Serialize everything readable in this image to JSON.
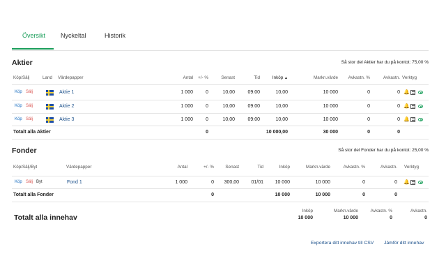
{
  "tabs": [
    "Översikt",
    "Nyckeltal",
    "Historik"
  ],
  "aktier": {
    "title": "Aktier",
    "info": "Så stor del Aktier har du på kontot: 75,00 %",
    "headers": [
      "Köp/Sälj",
      "Land",
      "Värdepapper",
      "Antal",
      "+/- %",
      "Senast",
      "Tid",
      "Inköp",
      "Markn.värde",
      "Avkastn. %",
      "Avkastn.",
      "Verktyg"
    ],
    "sort_indicator": "▲",
    "buy_label": "Köp",
    "sell_label": "Sälj",
    "rows": [
      {
        "name": "Aktie 1",
        "antal": "1 000",
        "change": "0",
        "senast": "10,00",
        "tid": "09:00",
        "inkop": "10,00",
        "marknvarde": "10 000",
        "avkastn_pct": "0",
        "avkastn": "0",
        "bell": "dark"
      },
      {
        "name": "Aktie 2",
        "antal": "1 000",
        "change": "0",
        "senast": "10,00",
        "tid": "09:00",
        "inkop": "10,00",
        "marknvarde": "10 000",
        "avkastn_pct": "0",
        "avkastn": "0",
        "bell": "green"
      },
      {
        "name": "Aktie 3",
        "antal": "1 000",
        "change": "0",
        "senast": "10,00",
        "tid": "09:00",
        "inkop": "10,00",
        "marknvarde": "10 000",
        "avkastn_pct": "0",
        "avkastn": "0",
        "bell": "dark"
      }
    ],
    "total": {
      "label": "Totalt alla Aktier",
      "change": "0",
      "inkop": "10 000,00",
      "marknvarde": "30 000",
      "avkastn_pct": "0",
      "avkastn": "0"
    }
  },
  "fonder": {
    "title": "Fonder",
    "info": "Så stor del Fonder har du på kontot: 25,00 %",
    "headers": [
      "Köp/Sälj/Byt",
      "Värdepapper",
      "Antal",
      "+/- %",
      "Senast",
      "Tid",
      "Inköp",
      "Markn.värde",
      "Avkastn. %",
      "Avkastn.",
      "Verktyg"
    ],
    "buy_label": "Köp",
    "sell_label": "Sälj",
    "swap_label": "Byt",
    "rows": [
      {
        "name": "Fond 1",
        "antal": "1 000",
        "change": "0",
        "senast": "300,00",
        "tid": "01/01",
        "inkop": "10 000",
        "marknvarde": "10 000",
        "avkastn_pct": "0",
        "avkastn": "0"
      }
    ],
    "total": {
      "label": "Totalt alla Fonder",
      "change": "0",
      "inkop": "10 000",
      "marknvarde": "10 000",
      "avkastn_pct": "0",
      "avkastn": "0"
    }
  },
  "summary": {
    "title": "Totalt alla innehav",
    "headers": [
      "Inköp",
      "Markn.värde",
      "Avkastn. %",
      "Avkastn."
    ],
    "values": [
      "10 000",
      "10 000",
      "0",
      "0"
    ]
  },
  "links": {
    "export": "Exportera ditt innehav till CSV",
    "compare": "Jämför ditt innehav"
  },
  "colors": {
    "accent": "#1a9e5a",
    "link": "#1a4f8a",
    "sell": "#d9534f",
    "buy": "#1a6ec0"
  }
}
